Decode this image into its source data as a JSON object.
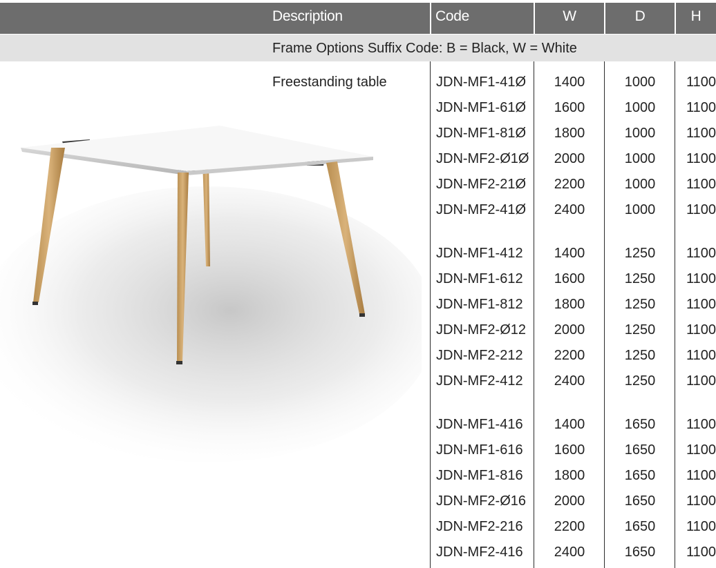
{
  "header": {
    "description": "Description",
    "code": "Code",
    "w": "W",
    "d": "D",
    "h": "H"
  },
  "options": {
    "text": "Frame Options Suffix Code: B = Black, W = White"
  },
  "product": {
    "description": "Freestanding table"
  },
  "rows": [
    {
      "code": "JDN-MF1-41Ø",
      "w": "1400",
      "d": "1000",
      "h": "1100"
    },
    {
      "code": "JDN-MF1-61Ø",
      "w": "1600",
      "d": "1000",
      "h": "1100"
    },
    {
      "code": "JDN-MF1-81Ø",
      "w": "1800",
      "d": "1000",
      "h": "1100"
    },
    {
      "code": "JDN-MF2-Ø1Ø",
      "w": "2000",
      "d": "1000",
      "h": "1100"
    },
    {
      "code": "JDN-MF2-21Ø",
      "w": "2200",
      "d": "1000",
      "h": "1100"
    },
    {
      "code": "JDN-MF2-41Ø",
      "w": "2400",
      "d": "1000",
      "h": "1100"
    },
    {
      "code": "JDN-MF1-412",
      "w": "1400",
      "d": "1250",
      "h": "1100"
    },
    {
      "code": "JDN-MF1-612",
      "w": "1600",
      "d": "1250",
      "h": "1100"
    },
    {
      "code": "JDN-MF1-812",
      "w": "1800",
      "d": "1250",
      "h": "1100"
    },
    {
      "code": "JDN-MF2-Ø12",
      "w": "2000",
      "d": "1250",
      "h": "1100"
    },
    {
      "code": "JDN-MF2-212",
      "w": "2200",
      "d": "1250",
      "h": "1100"
    },
    {
      "code": "JDN-MF2-412",
      "w": "2400",
      "d": "1250",
      "h": "1100"
    },
    {
      "code": "JDN-MF1-416",
      "w": "1400",
      "d": "1650",
      "h": "1100"
    },
    {
      "code": "JDN-MF1-616",
      "w": "1600",
      "d": "1650",
      "h": "1100"
    },
    {
      "code": "JDN-MF1-816",
      "w": "1800",
      "d": "1650",
      "h": "1100"
    },
    {
      "code": "JDN-MF2-Ø16",
      "w": "2000",
      "d": "1650",
      "h": "1100"
    },
    {
      "code": "JDN-MF2-216",
      "w": "2200",
      "d": "1650",
      "h": "1100"
    },
    {
      "code": "JDN-MF2-416",
      "w": "2400",
      "d": "1650",
      "h": "1100"
    }
  ]
}
